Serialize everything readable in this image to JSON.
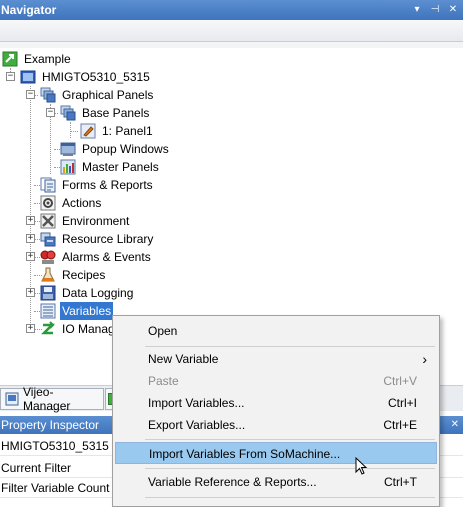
{
  "navigator": {
    "title": "Navigator",
    "ctrl_dropdown": "▾",
    "ctrl_pin": "⊣",
    "ctrl_close": "✕",
    "tree": [
      {
        "label": "Example",
        "icon": "project-icon"
      },
      {
        "label": "HMIGTO5310_5315",
        "icon": "hmi-target-icon"
      },
      {
        "label": "Graphical Panels",
        "icon": "panels-icon"
      },
      {
        "label": "Base Panels",
        "icon": "panels-icon"
      },
      {
        "label": "1: Panel1",
        "icon": "panel-edit-icon"
      },
      {
        "label": "Popup Windows",
        "icon": "popup-window-icon"
      },
      {
        "label": "Master Panels",
        "icon": "master-panel-icon"
      },
      {
        "label": "Forms & Reports",
        "icon": "forms-reports-icon"
      },
      {
        "label": "Actions",
        "icon": "actions-gear-icon"
      },
      {
        "label": "Environment",
        "icon": "environment-tools-icon"
      },
      {
        "label": "Resource Library",
        "icon": "resource-library-icon"
      },
      {
        "label": "Alarms & Events",
        "icon": "alarms-events-icon"
      },
      {
        "label": "Recipes",
        "icon": "recipes-flask-icon"
      },
      {
        "label": "Data Logging",
        "icon": "data-logging-icon"
      },
      {
        "label": "Variables",
        "icon": "variables-list-icon"
      },
      {
        "label": "IO Manag",
        "icon": "io-manager-icon"
      }
    ]
  },
  "tabs": {
    "vijeo_manager": "Vijeo-Manager"
  },
  "property_inspector": {
    "title": "Property Inspector",
    "rows": [
      "HMIGTO5310_5315",
      "Current Filter",
      "Filter Variable Count"
    ]
  },
  "context_menu": {
    "items": [
      {
        "label": "Open",
        "shortcut": ""
      },
      {
        "label": "New Variable",
        "shortcut": "›"
      },
      {
        "label": "Paste",
        "shortcut": "Ctrl+V"
      },
      {
        "label": "Import Variables...",
        "shortcut": "Ctrl+I"
      },
      {
        "label": "Export Variables...",
        "shortcut": "Ctrl+E"
      },
      {
        "label": "Import Variables From SoMachine...",
        "shortcut": ""
      },
      {
        "label": "Variable Reference & Reports...",
        "shortcut": "Ctrl+T"
      }
    ]
  },
  "colors": {
    "titlebar": "#3f74bd",
    "selection": "#3377d0",
    "menu_highlight": "#99c9ef"
  }
}
